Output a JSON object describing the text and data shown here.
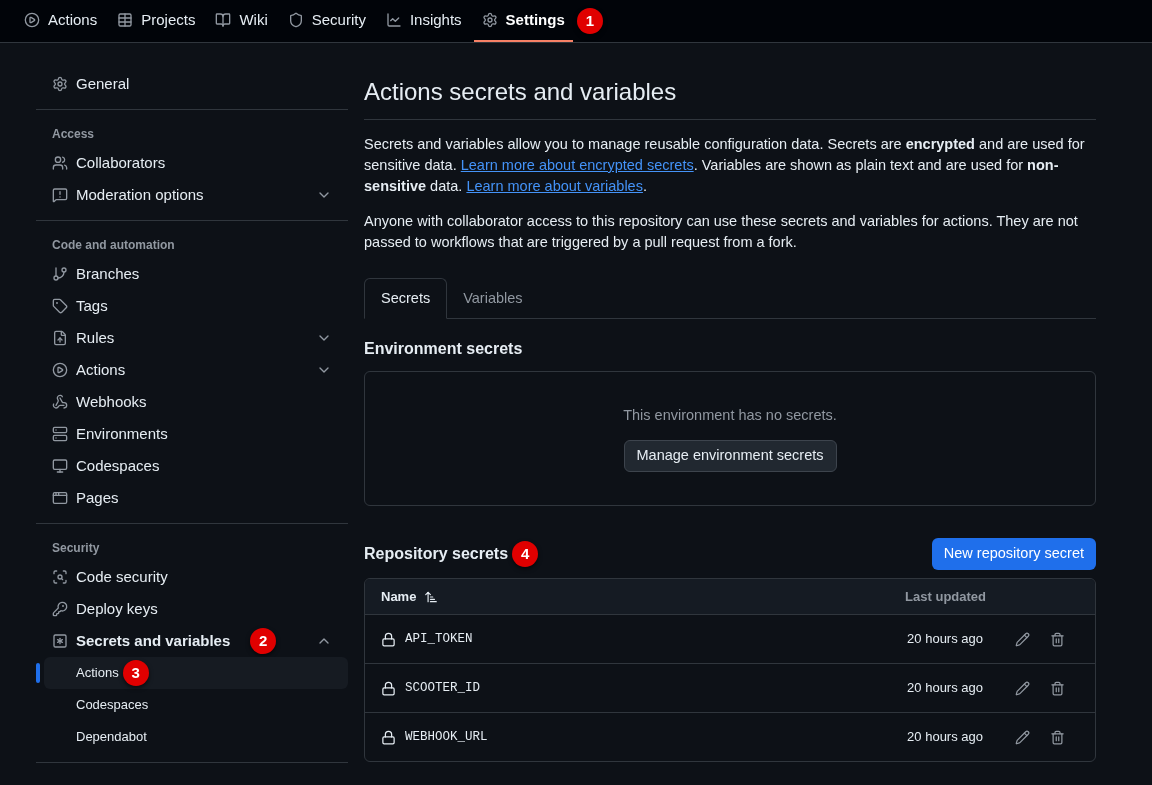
{
  "top_nav": {
    "items": [
      {
        "label": "Actions",
        "selected": false
      },
      {
        "label": "Projects",
        "selected": false
      },
      {
        "label": "Wiki",
        "selected": false
      },
      {
        "label": "Security",
        "selected": false
      },
      {
        "label": "Insights",
        "selected": false
      },
      {
        "label": "Settings",
        "selected": true,
        "callout": "1"
      }
    ]
  },
  "sidebar": {
    "top_item": {
      "label": "General"
    },
    "sections": [
      {
        "heading": "Access",
        "items": [
          {
            "label": "Collaborators"
          },
          {
            "label": "Moderation options",
            "expanded": false
          }
        ]
      },
      {
        "heading": "Code and automation",
        "items": [
          {
            "label": "Branches"
          },
          {
            "label": "Tags"
          },
          {
            "label": "Rules",
            "expanded": false
          },
          {
            "label": "Actions",
            "expanded": false
          },
          {
            "label": "Webhooks"
          },
          {
            "label": "Environments"
          },
          {
            "label": "Codespaces"
          },
          {
            "label": "Pages"
          }
        ]
      },
      {
        "heading": "Security",
        "items": [
          {
            "label": "Code security"
          },
          {
            "label": "Deploy keys"
          },
          {
            "label": "Secrets and variables",
            "expanded": true,
            "callout": "2",
            "children": [
              {
                "label": "Actions",
                "selected": true,
                "callout": "3"
              },
              {
                "label": "Codespaces",
                "selected": false
              },
              {
                "label": "Dependabot",
                "selected": false
              }
            ]
          }
        ]
      }
    ]
  },
  "main": {
    "title": "Actions secrets and variables",
    "paragraphs": [
      [
        {
          "kind": "text",
          "text": "Secrets and variables allow you to manage reusable configuration data. Secrets are **encrypted** and are used for sensitive data. "
        },
        {
          "kind": "link",
          "text": "Learn more about encrypted secrets"
        },
        {
          "kind": "text",
          "text": ". Variables are shown as plain text and are used for **non-sensitive** data. "
        },
        {
          "kind": "link",
          "text": "Learn more about variables"
        },
        {
          "kind": "text",
          "text": "."
        }
      ],
      [
        {
          "kind": "text",
          "text": "Anyone with collaborator access to this repository can use these secrets and variables for actions. They are not passed to workflows that are triggered by a pull request from a fork."
        }
      ]
    ],
    "tabs": [
      {
        "label": "Secrets",
        "selected": true
      },
      {
        "label": "Variables",
        "selected": false
      }
    ],
    "environment_secrets": {
      "heading": "Environment secrets",
      "empty_message": "This environment has no secrets.",
      "button": "Manage environment secrets"
    },
    "repository_secrets": {
      "heading": "Repository secrets",
      "callout": "4",
      "button": "New repository secret",
      "columns": [
        "Name",
        "Last updated"
      ],
      "rows": [
        {
          "name": "API_TOKEN",
          "last_updated": "20 hours ago"
        },
        {
          "name": "SCOOTER_ID",
          "last_updated": "20 hours ago"
        },
        {
          "name": "WEBHOOK_URL",
          "last_updated": "20 hours ago"
        }
      ]
    }
  }
}
